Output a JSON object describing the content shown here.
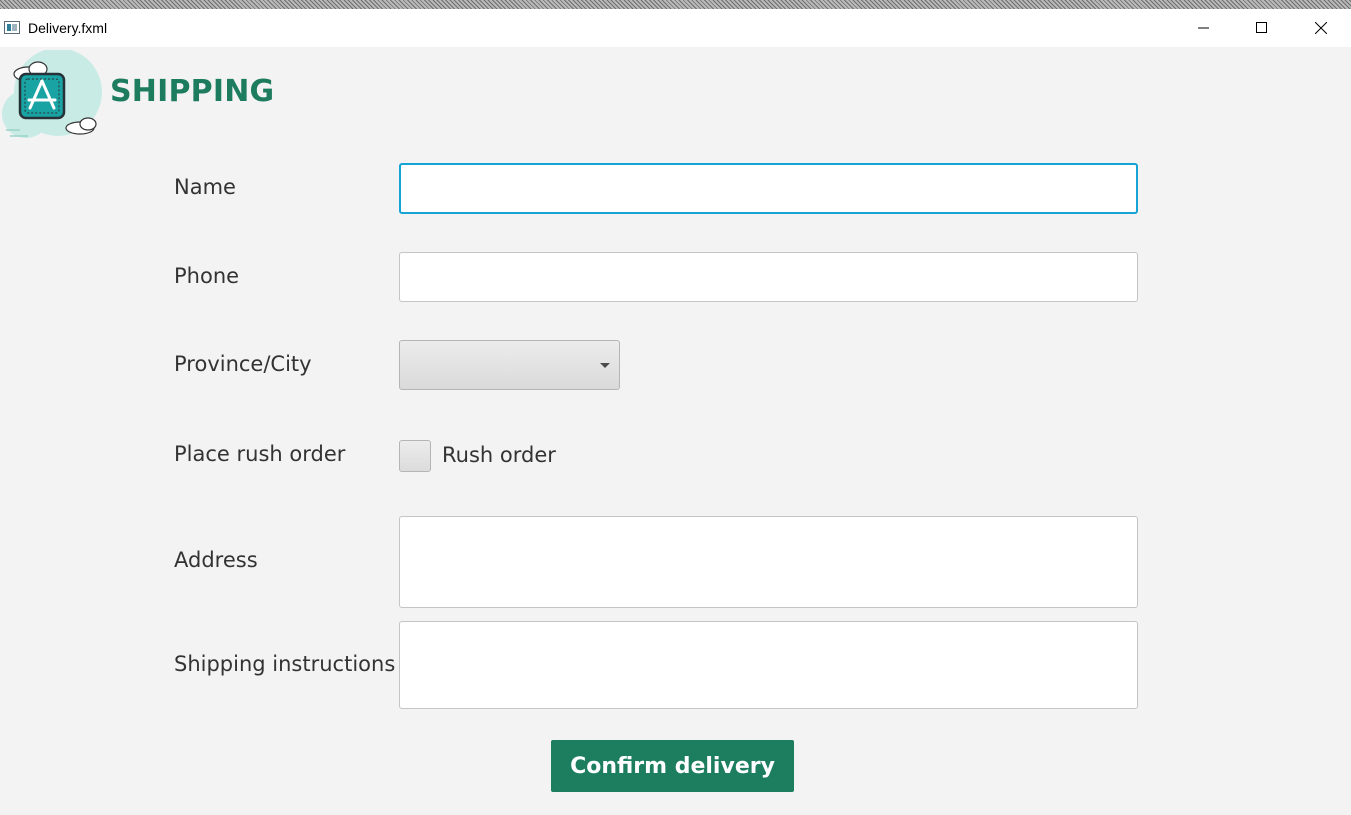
{
  "window": {
    "title": "Delivery.fxml",
    "icon": "app-window-icon",
    "controls": [
      "minimize-icon",
      "maximize-icon",
      "close-icon"
    ]
  },
  "header": {
    "heading": "SHIPPING",
    "logo_icon": "app-store-icon",
    "heading_color": "#1e7c5e"
  },
  "form": {
    "name": {
      "label": "Name",
      "value": ""
    },
    "phone": {
      "label": "Phone",
      "value": ""
    },
    "province": {
      "label": "Province/City",
      "selected": ""
    },
    "rush": {
      "label": "Place rush order",
      "checkbox_label": "Rush order",
      "checked": false
    },
    "address": {
      "label": "Address",
      "value": ""
    },
    "instructions": {
      "label": "Shipping instructions",
      "value": ""
    }
  },
  "actions": {
    "confirm_label": "Confirm delivery",
    "confirm_color": "#1c7e5f"
  },
  "colors": {
    "focus_border": "#16a3d6",
    "background": "#f3f3f3"
  }
}
